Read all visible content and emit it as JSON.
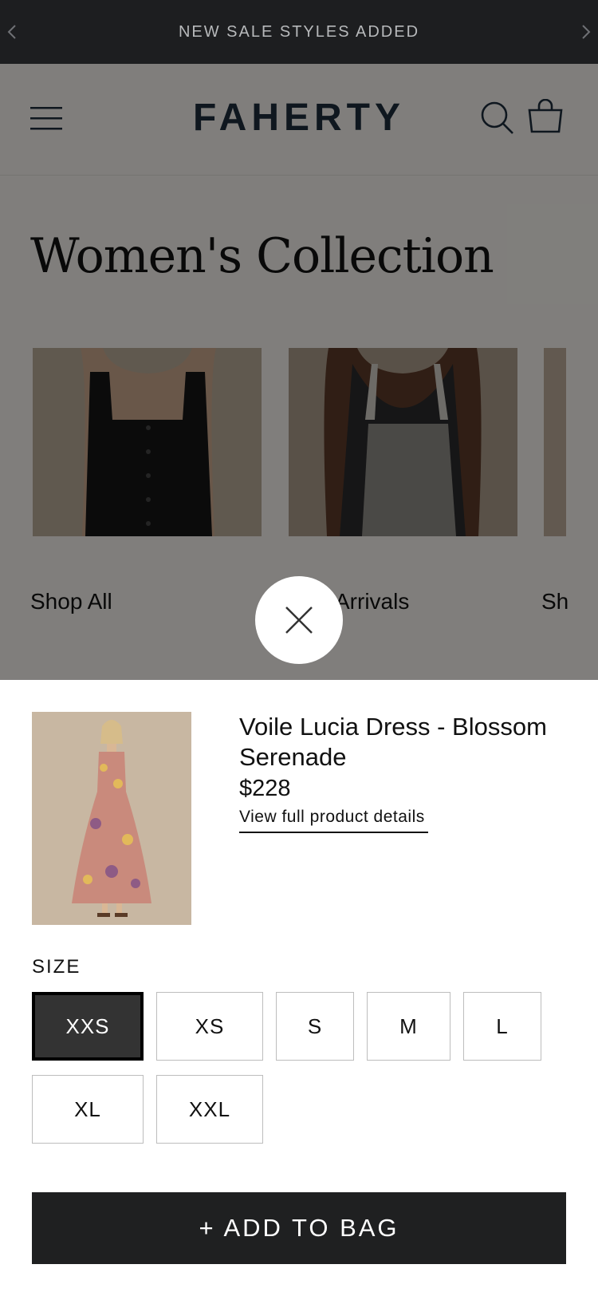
{
  "announcement": {
    "text": "NEW SALE STYLES ADDED",
    "prev_icon": "chevron-left-icon",
    "next_icon": "chevron-right-icon"
  },
  "header": {
    "logo": "FAHERTY",
    "icons": [
      "menu-icon",
      "search-icon",
      "bag-icon"
    ]
  },
  "collection": {
    "title": "Women's Collection",
    "cards": [
      {
        "label": "Shop All"
      },
      {
        "label": "Arrivals"
      },
      {
        "label": "Sh"
      }
    ]
  },
  "quick_add": {
    "close_icon": "close-icon",
    "product": {
      "name": "Voile Lucia Dress - Blossom Serenade",
      "price": "$228",
      "details_link": "View full product details"
    },
    "size_label": "SIZE",
    "sizes": [
      "XXS",
      "XS",
      "S",
      "M",
      "L",
      "XL",
      "XXL"
    ],
    "selected_size": "XXS",
    "add_button": "+ ADD TO BAG"
  },
  "colors": {
    "announcement_bg": "#1d1e20",
    "logo": "#1d2c3c",
    "selected_size_bg": "#333333",
    "button_bg": "#1f2021"
  }
}
